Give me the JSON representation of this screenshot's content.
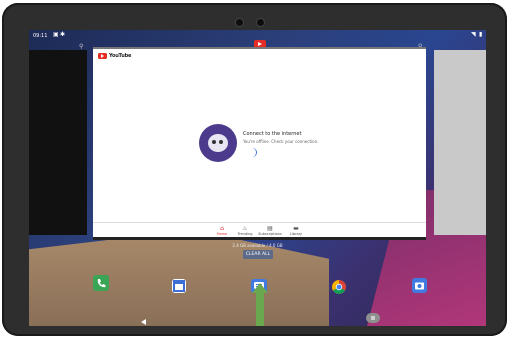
{
  "status_bar": {
    "time": "09:11",
    "icons": [
      "notification-icon",
      "settings-icon",
      "wifi-icon",
      "battery-icon"
    ]
  },
  "recents": {
    "app_name": "YouTube",
    "app_icon": "youtube-icon",
    "lock_icon": "lock-icon",
    "app_logo": "YouTube",
    "error": {
      "title": "Connect to the internet",
      "subtitle": "You're offline. Check your connection."
    },
    "tabs": [
      {
        "label": "Home",
        "icon": "home-icon"
      },
      {
        "label": "Trending",
        "icon": "trending-icon"
      },
      {
        "label": "Subscriptions",
        "icon": "subscriptions-icon"
      },
      {
        "label": "Library",
        "icon": "library-icon"
      }
    ],
    "storage": "2.4 GB available / 4.0 GB",
    "clear_all_label": "CLEAR ALL"
  },
  "dock": [
    "phone-icon",
    "calendar-icon",
    "messages-icon",
    "chrome-icon",
    "camera-icon"
  ],
  "nav": [
    "back-icon",
    "home-icon",
    "recents-icon"
  ],
  "colors": {
    "accent": "#e52d27",
    "arrow": "#6aa84f"
  }
}
